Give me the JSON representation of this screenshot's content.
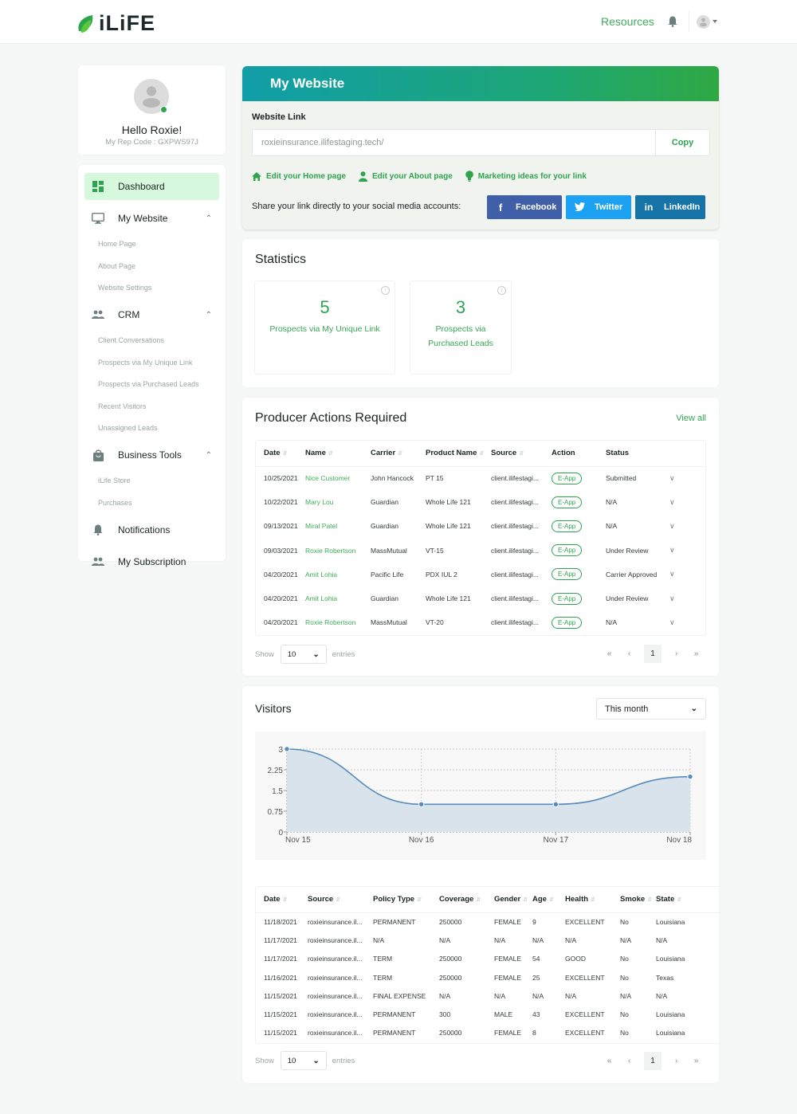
{
  "header": {
    "logo_text": "iLiFE",
    "resources_link": "Resources",
    "icons": [
      "bell-icon",
      "user-avatar-icon",
      "caret-down-icon"
    ]
  },
  "profile": {
    "greeting": "Hello Roxie!",
    "rep_code": "My Rep Code : GXPWS97J",
    "online_status_color": "#2ea44f"
  },
  "sidebar": {
    "items": [
      {
        "label": "Dashboard",
        "icon": "dashboard-icon",
        "active": true
      },
      {
        "label": "My Website",
        "icon": "monitor-icon",
        "expanded": true,
        "sub": [
          "Home Page",
          "About Page",
          "Website Settings"
        ]
      },
      {
        "label": "CRM",
        "icon": "people-icon",
        "expanded": true,
        "sub": [
          "Client Conversations",
          "Prospects via My Unique Link",
          "Prospects via Purchased Leads",
          "Recent Visitors",
          "Unassigned Leads"
        ]
      },
      {
        "label": "Business Tools",
        "icon": "shopping-bag-icon",
        "expanded": true,
        "sub": [
          "iLife Store",
          "Purchases"
        ]
      },
      {
        "label": "Notifications",
        "icon": "bell-icon"
      },
      {
        "label": "My Subscription",
        "icon": "people-icon"
      }
    ]
  },
  "my_website": {
    "title": "My Website",
    "link_label": "Website Link",
    "link_value": "roxieinsurance.ilifestaging.tech/",
    "copy_label": "Copy",
    "links": [
      "Edit your Home page",
      "Edit your About page",
      "Marketing ideas for your link"
    ],
    "share_text": "Share your link directly to your social media accounts:",
    "social": [
      {
        "label": "Facebook",
        "color": "#3f5fa8"
      },
      {
        "label": "Twitter",
        "color": "#1da1f2"
      },
      {
        "label": "LinkedIn",
        "color": "#1673a8"
      }
    ]
  },
  "statistics": {
    "title": "Statistics",
    "cards": [
      {
        "value": "5",
        "label_lines": [
          "Prospects via My Unique Link"
        ]
      },
      {
        "value": "3",
        "label_lines": [
          "Prospects via",
          "Purchased Leads"
        ]
      }
    ]
  },
  "producer_actions": {
    "title": "Producer Actions Required",
    "view_all": "View all",
    "columns": [
      "Date",
      "Name",
      "Carrier",
      "Product Name",
      "Source",
      "Action",
      "Status"
    ],
    "rows": [
      {
        "date": "10/25/2021",
        "name": "Nice Customer",
        "carrier": "John Hancock",
        "product": "PT 15",
        "source": "client.ilifestagi...",
        "action": "E-App",
        "status": "Submitted"
      },
      {
        "date": "10/22/2021",
        "name": "Mary Lou",
        "carrier": "Guardian",
        "product": "Whole Life 121",
        "source": "client.ilifestagi...",
        "action": "E-App",
        "status": "N/A"
      },
      {
        "date": "09/13/2021",
        "name": "Miral Patel",
        "carrier": "Guardian",
        "product": "Whole Life 121",
        "source": "client.ilifestagi...",
        "action": "E-App",
        "status": "N/A"
      },
      {
        "date": "09/03/2021",
        "name": "Roxie Robertson",
        "carrier": "MassMutual",
        "product": "VT-15",
        "source": "client.ilifestagi...",
        "action": "E-App",
        "status": "Under Review"
      },
      {
        "date": "04/20/2021",
        "name": "Amit Lohia",
        "carrier": "Pacific Life",
        "product": "PDX IUL 2",
        "source": "client.ilifestagi...",
        "action": "E-App",
        "status": "Carrier Approved"
      },
      {
        "date": "04/20/2021",
        "name": "Amit Lohia",
        "carrier": "Guardian",
        "product": "Whole Life 121",
        "source": "client.ilifestagi...",
        "action": "E-App",
        "status": "Under Review"
      },
      {
        "date": "04/20/2021",
        "name": "Roxie Robertson",
        "carrier": "MassMutual",
        "product": "VT-20",
        "source": "client.ilifestagi...",
        "action": "E-App",
        "status": "N/A"
      }
    ],
    "show_label": "Show",
    "entries_value": "10",
    "entries_label": "entries",
    "page": "1"
  },
  "visitors": {
    "title": "Visitors",
    "range": "This month",
    "columns": [
      "Date",
      "Source",
      "Policy Type",
      "Coverage",
      "Gender",
      "Age",
      "Health",
      "Smoke",
      "State"
    ],
    "rows": [
      [
        "11/18/2021",
        "roxieinsurance.il...",
        "PERMANENT",
        "250000",
        "FEMALE",
        "9",
        "EXCELLENT",
        "No",
        "Louisiana"
      ],
      [
        "11/17/2021",
        "roxieinsurance.il...",
        "N/A",
        "N/A",
        "N/A",
        "N/A",
        "N/A",
        "N/A",
        "N/A"
      ],
      [
        "11/17/2021",
        "roxieinsurance.il...",
        "TERM",
        "250000",
        "FEMALE",
        "54",
        "GOOD",
        "No",
        "Louisiana"
      ],
      [
        "11/16/2021",
        "roxieinsurance.il...",
        "TERM",
        "250000",
        "FEMALE",
        "25",
        "EXCELLENT",
        "No",
        "Texas"
      ],
      [
        "11/15/2021",
        "roxieinsurance.il...",
        "FINAL EXPENSE",
        "N/A",
        "N/A",
        "N/A",
        "N/A",
        "N/A",
        "N/A"
      ],
      [
        "11/15/2021",
        "roxieinsurance.il...",
        "PERMANENT",
        "300",
        "MALE",
        "43",
        "EXCELLENT",
        "No",
        "Louisiana"
      ],
      [
        "11/15/2021",
        "roxieinsurance.il...",
        "PERMANENT",
        "250000",
        "FEMALE",
        "8",
        "EXCELLENT",
        "No",
        "Louisiana"
      ]
    ],
    "show_label": "Show",
    "entries_value": "10",
    "entries_label": "entries",
    "page": "1"
  },
  "chart_data": {
    "type": "area",
    "title": "Visitors",
    "x": [
      "Nov 15",
      "Nov 16",
      "Nov 17",
      "Nov 18"
    ],
    "series": [
      {
        "name": "Visitors",
        "values": [
          3,
          1,
          1,
          2
        ],
        "color": "#5b8bbb"
      }
    ],
    "yticks": [
      "0",
      "0.75",
      "1.5",
      "2.25",
      "3"
    ],
    "ylim": [
      0,
      3
    ],
    "grid": true,
    "xlabel": "",
    "ylabel": ""
  }
}
